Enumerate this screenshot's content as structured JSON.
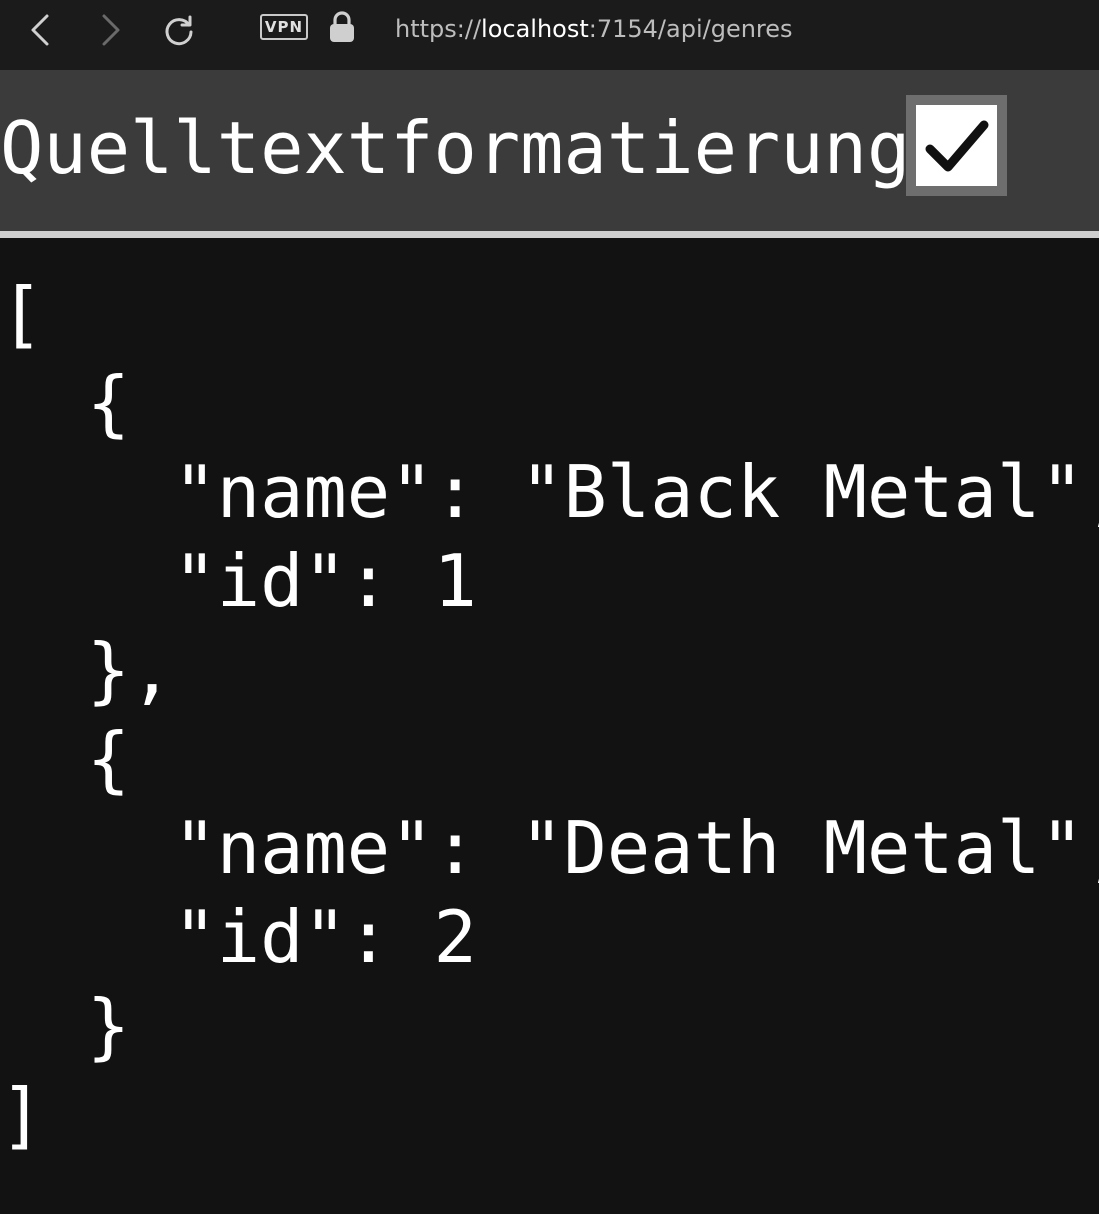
{
  "browser": {
    "vpn_label": "VPN",
    "url": {
      "scheme": "https://",
      "host": "localhost",
      "rest": ":7154/api/genres"
    },
    "icons": {
      "back": "chevron-left-icon",
      "forward": "chevron-right-icon",
      "reload": "reload-icon",
      "lock": "lock-icon"
    }
  },
  "pretty_print": {
    "label": "Quelltextformatierung",
    "checked": true
  },
  "json_lines": {
    "l1": "[",
    "l2": "  {",
    "l3": "    \"name\": \"Black Metal\",",
    "l4": "    \"id\": 1",
    "l5": "  },",
    "l6": "  {",
    "l7": "    \"name\": \"Death Metal\",",
    "l8": "    \"id\": 2",
    "l9": "  }",
    "l10": "]"
  },
  "colors": {
    "page_bg": "#121212",
    "toolbar_bg": "#1b1b1b",
    "pp_bar_bg": "#3b3b3b",
    "checkbox_frame": "#6e6e6e",
    "text": "#ffffff"
  }
}
